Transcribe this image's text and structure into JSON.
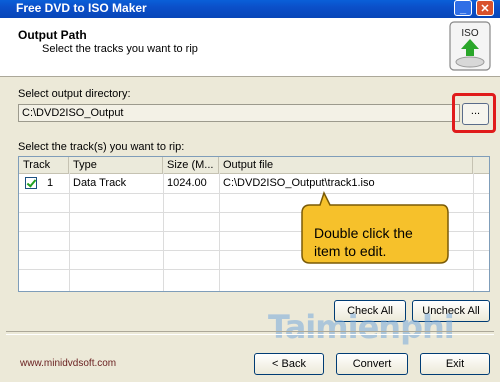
{
  "window": {
    "title": "Free DVD to ISO Maker",
    "minimize_label": "_",
    "close_label": "✕"
  },
  "header": {
    "title": "Output Path",
    "subtitle": "Select the tracks you want to rip",
    "icon_label": "ISO"
  },
  "output_directory": {
    "label": "Select output directory:",
    "value": "C:\\DVD2ISO_Output",
    "browse_label": "..."
  },
  "tracks": {
    "label": "Select the track(s) you want to rip:",
    "columns": [
      "Track",
      "Type",
      "Size (M...",
      "Output file"
    ],
    "rows": [
      {
        "checked": true,
        "track": "1",
        "type": "Data Track",
        "size": "1024.00",
        "output": "C:\\DVD2ISO_Output\\track1.iso"
      }
    ]
  },
  "callout": {
    "line1": "Double click the",
    "line2": "item to edit."
  },
  "buttons": {
    "check_all": "Check All",
    "uncheck_all": "Uncheck All",
    "back": "< Back",
    "convert": "Convert",
    "exit": "Exit"
  },
  "footer": {
    "url": "www.minidvdsoft.com"
  },
  "watermark": "Taimienphi",
  "colors": {
    "titlebar": "#0b4fc9",
    "highlight": "#e01b1b",
    "callout_fill": "#f6c12b",
    "callout_border": "#7a5a06"
  }
}
